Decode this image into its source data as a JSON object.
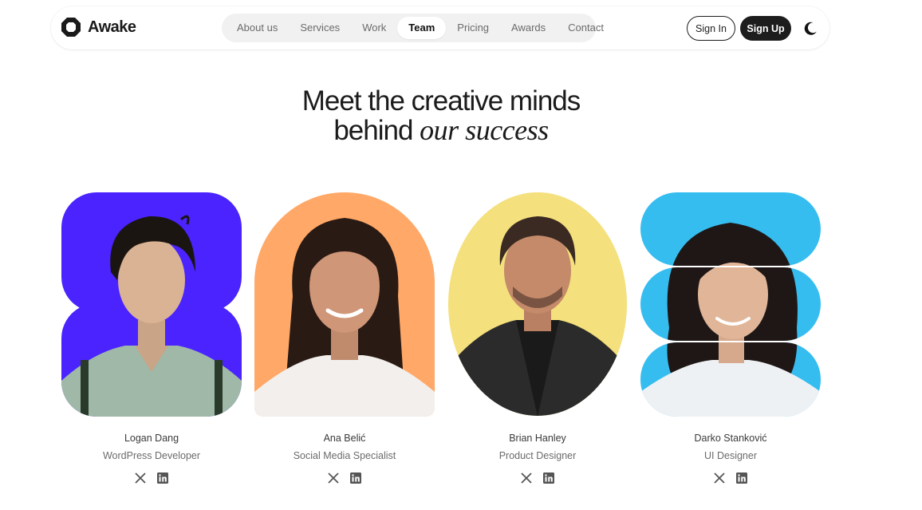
{
  "brand": {
    "name": "Awake"
  },
  "nav": {
    "items": [
      {
        "label": "About us",
        "active": false
      },
      {
        "label": "Services",
        "active": false
      },
      {
        "label": "Work",
        "active": false
      },
      {
        "label": "Team",
        "active": true
      },
      {
        "label": "Pricing",
        "active": false
      },
      {
        "label": "Awards",
        "active": false
      },
      {
        "label": "Contact",
        "active": false
      }
    ],
    "sign_in": "Sign In",
    "sign_up": "Sign Up",
    "theme_icon": "moon-icon"
  },
  "hero": {
    "line1": "Meet the creative minds",
    "line2_plain": "behind",
    "line2_accent": "our success"
  },
  "team": [
    {
      "name": "Logan Dang",
      "role": "WordPress Developer",
      "bg_color": "#4a23ff",
      "shape": "rounded-rect-double",
      "socials": [
        "x-icon",
        "linkedin-icon"
      ]
    },
    {
      "name": "Ana Belić",
      "role": "Social Media Specialist",
      "bg_color": "#ffa867",
      "shape": "arch",
      "socials": [
        "x-icon",
        "linkedin-icon"
      ]
    },
    {
      "name": "Brian Hanley",
      "role": "Product Designer",
      "bg_color": "#f4e07c",
      "shape": "oval",
      "socials": [
        "x-icon",
        "linkedin-icon"
      ]
    },
    {
      "name": "Darko Stanković",
      "role": "UI Designer",
      "bg_color": "#36bdf0",
      "shape": "stacked-pills",
      "socials": [
        "x-icon",
        "linkedin-icon"
      ]
    }
  ]
}
